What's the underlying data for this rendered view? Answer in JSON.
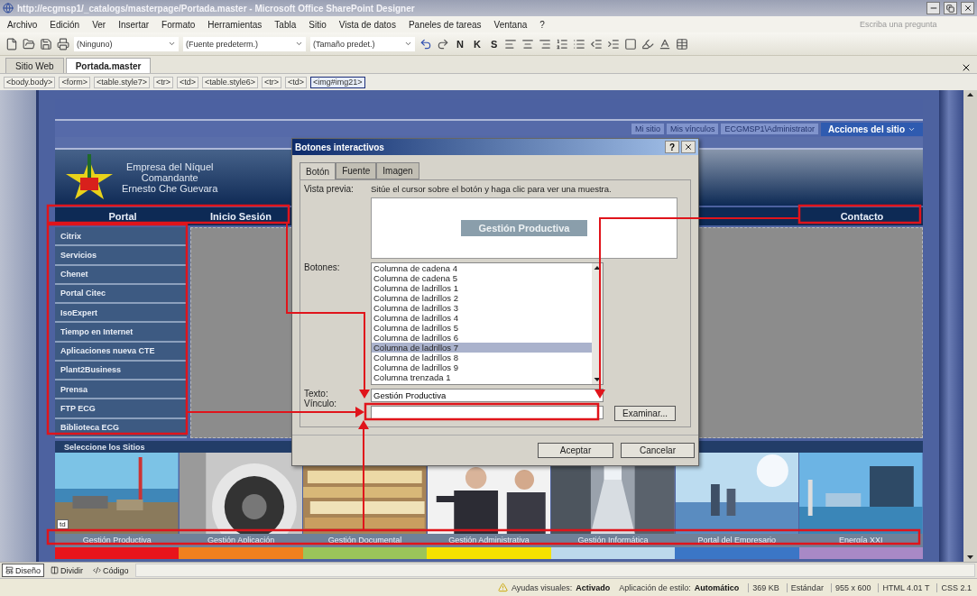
{
  "window": {
    "title": "http://ecgmsp1/_catalogs/masterpage/Portada.master - Microsoft Office SharePoint Designer"
  },
  "menu": [
    "Archivo",
    "Edición",
    "Ver",
    "Insertar",
    "Formato",
    "Herramientas",
    "Tabla",
    "Sitio",
    "Vista de datos",
    "Paneles de tareas",
    "Ventana",
    "?"
  ],
  "help_box": {
    "placeholder": "Escriba una pregunta"
  },
  "toolbar": {
    "style": "(Ninguno)",
    "font": "(Fuente predeterm.)",
    "size": "(Tamaño predet.)",
    "format_buttons": [
      "N",
      "K",
      "S"
    ]
  },
  "doc_tabs": [
    {
      "label": "Sitio Web",
      "selected": false
    },
    {
      "label": "Portada.master",
      "selected": true
    }
  ],
  "breadcrumb": [
    {
      "label": "<body.body>",
      "selected": false
    },
    {
      "label": "<form>",
      "selected": false
    },
    {
      "label": "<table.style7>",
      "selected": false
    },
    {
      "label": "<tr>",
      "selected": false
    },
    {
      "label": "<td>",
      "selected": false
    },
    {
      "label": "<table.style6>",
      "selected": false
    },
    {
      "label": "<tr>",
      "selected": false
    },
    {
      "label": "<td>",
      "selected": false
    },
    {
      "label": "<img#img21>",
      "selected": true
    }
  ],
  "page": {
    "top_links": [
      "Mi sitio",
      "Mis vínculos",
      "ECGMSP1\\Administrator"
    ],
    "site_actions": "Acciones del sitio",
    "logo_text": [
      "Empresa del Níquel",
      "Comandante",
      "Ernesto Che Guevara"
    ],
    "nav": [
      "Portal",
      "Inicio Sesión",
      "Contacto"
    ],
    "side_menu": [
      "Citrix",
      "Servicios",
      "Chenet",
      "Portal Citec",
      "IsoExpert",
      "Tiempo en Internet",
      "Aplicaciones nueva CTE",
      "Plant2Business",
      "Prensa",
      "FTP ECG",
      "Biblioteca ECG"
    ],
    "sites_heading": "Seleccione los Sitios",
    "cell_tag": "td",
    "sites": [
      {
        "label": "Gestión Productiva",
        "color": "#e8141b"
      },
      {
        "label": "Gestión Aplicación",
        "color": "#f0801e"
      },
      {
        "label": "Gestión Documental",
        "color": "#9bc45a"
      },
      {
        "label": "Gestión Administrativa",
        "color": "#f5e200"
      },
      {
        "label": "Gestión Informática",
        "color": "#bcd9ec"
      },
      {
        "label": "Portal del Empresario",
        "color": "#3b76c6"
      },
      {
        "label": "Energía XXI",
        "color": "#a889c6"
      }
    ]
  },
  "dialog": {
    "title": "Botones interactivos",
    "help_button": "?",
    "tabs": [
      {
        "label": "Botón",
        "selected": true
      },
      {
        "label": "Fuente",
        "selected": false
      },
      {
        "label": "Imagen",
        "selected": false
      }
    ],
    "preview_label": "Vista previa:",
    "preview_hint": "Sitúe el cursor sobre el botón y haga clic para ver una muestra.",
    "preview_button": "Gestión Productiva",
    "buttons_label": "Botones:",
    "buttons_list": [
      {
        "label": "Columna de cadena 4",
        "selected": false
      },
      {
        "label": "Columna de cadena 5",
        "selected": false
      },
      {
        "label": "Columna de ladrillos 1",
        "selected": false
      },
      {
        "label": "Columna de ladrillos 2",
        "selected": false
      },
      {
        "label": "Columna de ladrillos 3",
        "selected": false
      },
      {
        "label": "Columna de ladrillos 4",
        "selected": false
      },
      {
        "label": "Columna de ladrillos 5",
        "selected": false
      },
      {
        "label": "Columna de ladrillos 6",
        "selected": false
      },
      {
        "label": "Columna de ladrillos 7",
        "selected": true
      },
      {
        "label": "Columna de ladrillos 8",
        "selected": false
      },
      {
        "label": "Columna de ladrillos 9",
        "selected": false
      },
      {
        "label": "Columna trenzada 1",
        "selected": false
      }
    ],
    "text_label": "Texto:",
    "text_value": "Gestión Productiva",
    "link_label": "Vínculo:",
    "browse": "Examinar...",
    "ok": "Aceptar",
    "cancel": "Cancelar"
  },
  "view_tabs": [
    {
      "label": "Diseño",
      "selected": true
    },
    {
      "label": "Dividir",
      "selected": false
    },
    {
      "label": "Código",
      "selected": false
    }
  ],
  "status_bar": [
    {
      "label": "Ayudas visuales:",
      "value": "Activado"
    },
    {
      "label": "Aplicación de estilo:",
      "value": "Automático"
    }
  ],
  "status_cells": [
    "369 KB",
    "Estándar",
    "955 x 600",
    "HTML 4.01 T",
    "CSS 2.1"
  ]
}
